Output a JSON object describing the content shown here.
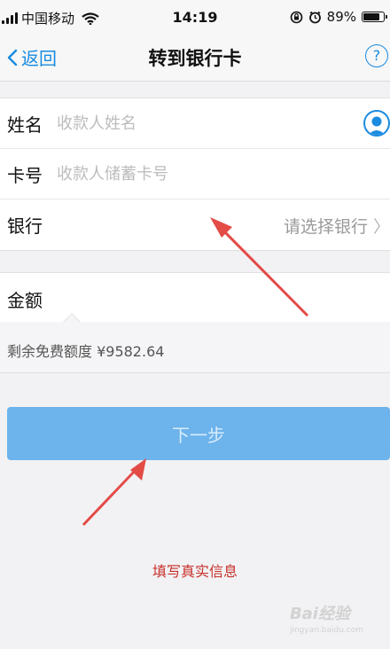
{
  "status_bar": {
    "carrier": "中国移动",
    "time": "14:19",
    "battery": "89%"
  },
  "nav": {
    "back_label": "返回",
    "title": "转到银行卡",
    "help_label": "?"
  },
  "form": {
    "name_label": "姓名",
    "name_placeholder": "收款人姓名",
    "card_label": "卡号",
    "card_placeholder": "收款人储蓄卡号",
    "bank_label": "银行",
    "bank_select": "请选择银行",
    "amount_label": "金额",
    "free_quota": "剩余免费额度 ¥9582.64"
  },
  "next_button": "下一步",
  "annotation": "填写真实信息",
  "watermark": {
    "brand": "Bai经验",
    "url": "jingyan.baidu.com"
  },
  "colors": {
    "accent": "#1a8be0",
    "button": "#6db3ec",
    "annotation": "#c8302a"
  }
}
